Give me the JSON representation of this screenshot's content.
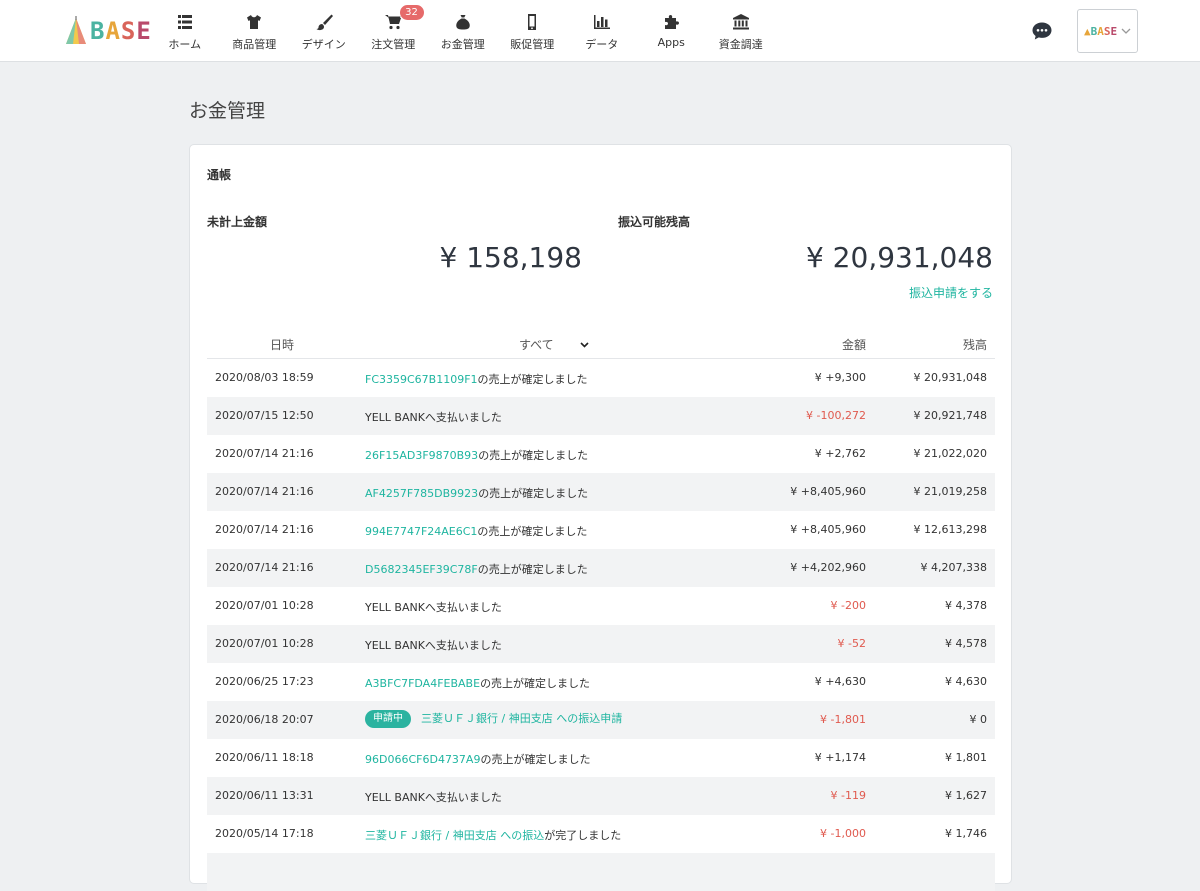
{
  "header": {
    "logo_text": "BASE",
    "nav": [
      {
        "label": "ホーム",
        "icon": "list-icon"
      },
      {
        "label": "商品管理",
        "icon": "shirt-icon"
      },
      {
        "label": "デザイン",
        "icon": "brush-icon"
      },
      {
        "label": "注文管理",
        "icon": "cart-icon",
        "badge": "32"
      },
      {
        "label": "お金管理",
        "icon": "money-bag-icon"
      },
      {
        "label": "販促管理",
        "icon": "smartphone-icon"
      },
      {
        "label": "データ",
        "icon": "bar-chart-icon"
      },
      {
        "label": "Apps",
        "icon": "puzzle-icon"
      },
      {
        "label": "資金調達",
        "icon": "bank-icon"
      }
    ],
    "shop_logo_text": "BASE"
  },
  "page": {
    "title": "お金管理",
    "card_title": "通帳",
    "unsettled_label": "未計上金額",
    "unsettled_amount": "¥ 158,198",
    "withdrawable_label": "振込可能残高",
    "withdrawable_amount": "¥ 20,931,048",
    "transfer_link": "振込申請をする"
  },
  "table": {
    "headers": {
      "date": "日時",
      "filter": "すべて",
      "amount": "金額",
      "balance": "残高"
    },
    "rows": [
      {
        "date": "2020/08/03 18:59",
        "link": "FC3359C67B1109F1",
        "text": "の売上が確定しました",
        "amount": "¥ +9,300",
        "balance": "¥ 20,931,048"
      },
      {
        "date": "2020/07/15 12:50",
        "link": "",
        "text": "YELL BANKへ支払いました",
        "amount": "¥ -100,272",
        "balance": "¥ 20,921,748",
        "neg": true
      },
      {
        "date": "2020/07/14 21:16",
        "link": "26F15AD3F9870B93",
        "text": "の売上が確定しました",
        "amount": "¥ +2,762",
        "balance": "¥ 21,022,020"
      },
      {
        "date": "2020/07/14 21:16",
        "link": "AF4257F785DB9923",
        "text": "の売上が確定しました",
        "amount": "¥ +8,405,960",
        "balance": "¥ 21,019,258"
      },
      {
        "date": "2020/07/14 21:16",
        "link": "994E7747F24AE6C1",
        "text": "の売上が確定しました",
        "amount": "¥ +8,405,960",
        "balance": "¥ 12,613,298"
      },
      {
        "date": "2020/07/14 21:16",
        "link": "D5682345EF39C78F",
        "text": "の売上が確定しました",
        "amount": "¥ +4,202,960",
        "balance": "¥ 4,207,338"
      },
      {
        "date": "2020/07/01 10:28",
        "link": "",
        "text": "YELL BANKへ支払いました",
        "amount": "¥ -200",
        "balance": "¥ 4,378",
        "neg": true
      },
      {
        "date": "2020/07/01 10:28",
        "link": "",
        "text": "YELL BANKへ支払いました",
        "amount": "¥ -52",
        "balance": "¥ 4,578",
        "neg": true
      },
      {
        "date": "2020/06/25 17:23",
        "link": "A3BFC7FDA4FEBABE",
        "text": "の売上が確定しました",
        "amount": "¥ +4,630",
        "balance": "¥ 4,630"
      },
      {
        "date": "2020/06/18 20:07",
        "pill": "申請中",
        "link": "三菱ＵＦＪ銀行 / 神田支店 への振込申請",
        "text": "",
        "amount": "¥ -1,801",
        "balance": "¥ 0",
        "neg": true
      },
      {
        "date": "2020/06/11 18:18",
        "link": "96D066CF6D4737A9",
        "text": "の売上が確定しました",
        "amount": "¥ +1,174",
        "balance": "¥ 1,801"
      },
      {
        "date": "2020/06/11 13:31",
        "link": "",
        "text": "YELL BANKへ支払いました",
        "amount": "¥ -119",
        "balance": "¥ 1,627",
        "neg": true
      },
      {
        "date": "2020/05/14 17:18",
        "link": "三菱ＵＦＪ銀行 / 神田支店 への振込",
        "text": "が完了しました",
        "amount": "¥ -1,000",
        "balance": "¥ 1,746",
        "neg": true
      },
      {
        "date": "",
        "link": "",
        "text": "",
        "amount": "",
        "balance": ""
      }
    ]
  },
  "colors": {
    "accent": "#1fb5a0",
    "negative": "#e05a4f",
    "badge": "#e66a6a"
  }
}
